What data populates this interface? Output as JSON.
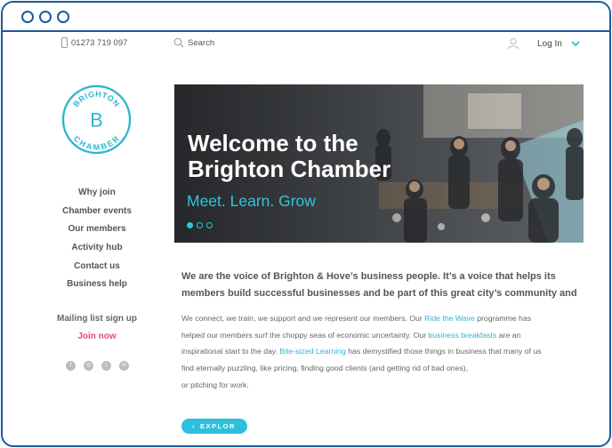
{
  "topbar": {
    "phone": "01273 719 097",
    "search_label": "Search",
    "login_label": "Log In"
  },
  "logo": {
    "line1": "BRIGHTON",
    "line2": "CHAMBER",
    "monogram": "B",
    "color": "#2cb5d0"
  },
  "nav": {
    "items": [
      "Why join",
      "Chamber events",
      "Our members",
      "Activity hub",
      "Contact us",
      "Business help"
    ],
    "mailing": "Mailing list sign up",
    "join": "Join now"
  },
  "social": [
    {
      "icon": "facebook-icon",
      "glyph": "f"
    },
    {
      "icon": "instagram-icon",
      "glyph": "◎"
    },
    {
      "icon": "twitter-icon",
      "glyph": "t"
    },
    {
      "icon": "linkedin-icon",
      "glyph": "in"
    }
  ],
  "hero": {
    "title": "Welcome to the Brighton Chamber",
    "subtitle": "Meet. Learn. Grow",
    "slides": 3,
    "active_slide": 1
  },
  "intro": {
    "lead": "We are the voice of Brighton & Hove’s business people. It’s a voice that helps its members build successful businesses and be part of this great city’s community and",
    "p1_a": "We connect, we train, we support and we represent our members. Our ",
    "p1_link": "Ride the Wave",
    "p1_b": " programme has",
    "p2_a": "helped our members surf the choppy seas of economic uncertainty. Our ",
    "p2_link": "business breakfasts",
    "p2_b": " are an",
    "p3_a": "inspirational start to the day. ",
    "p3_link": "Bite-sized Learning",
    "p3_b": " has demystified those things in business that many of us",
    "p4": "find eternally puzzling, like pricing, finding good clients (and getting rid of bad ones),",
    "p5": "or pitching for work."
  },
  "explore_label": "EXPLOR",
  "colors": {
    "accent": "#2cb5d0",
    "frame": "#1c5a9c",
    "join": "#e24a7d"
  }
}
